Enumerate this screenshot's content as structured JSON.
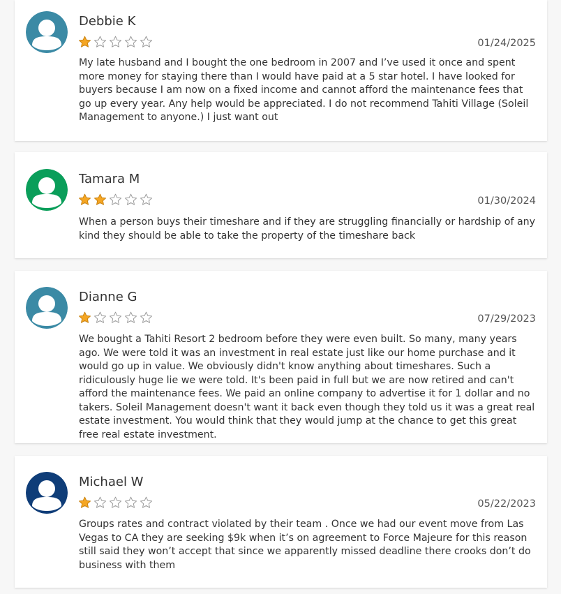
{
  "colors": {
    "star_filled": "#f5a623",
    "star_empty_outline": "#9a9a9a",
    "avatar_default": "#3b8aa5"
  },
  "reviews": [
    {
      "name": "Debbie K",
      "rating": 1,
      "max_rating": 5,
      "date": "01/24/2025",
      "avatar_color": "#3b8aa5",
      "avatar_icon": "user-silhouette-icon",
      "text": "My late husband and I bought the one bedroom in 2007 and I’ve used it once and spent more money for staying there than I would have paid at a 5 star hotel. I have looked for buyers because I am now on a fixed income and cannot afford the maintenance fees that go up every year. Any help would be appreciated. I do not recommend Tahiti Village (Soleil Management to anyone.) I just want out"
    },
    {
      "name": "Tamara M",
      "rating": 2,
      "max_rating": 5,
      "date": "01/30/2024",
      "avatar_color": "#0a9e5a",
      "avatar_icon": "user-silhouette-icon",
      "text": "When a person buys their timeshare and if they are struggling financially or hardship of any kind they should be able to take the property of the timeshare back"
    },
    {
      "name": "Dianne G",
      "rating": 1,
      "max_rating": 5,
      "date": "07/29/2023",
      "avatar_color": "#3b8aa5",
      "avatar_icon": "user-silhouette-icon",
      "text": "We bought a Tahiti Resort 2 bedroom before they were even built. So many, many years ago. We were told it was an investment in real estate just like our home purchase and it would go up in value. We obviously didn't know anything about timeshares. Such a ridiculously huge lie we were told. It's been paid in full but we are now retired and can't afford the maintenance fees. We paid an online company to advertise it for 1 dollar and no takers. Soleil Management doesn't want it back even though they told us it was a great real estate investment. You would think that they would jump at the chance to get this great free real estate investment."
    },
    {
      "name": "Michael W",
      "rating": 1,
      "max_rating": 5,
      "date": "05/22/2023",
      "avatar_color": "#0f3d78",
      "avatar_icon": "user-silhouette-icon",
      "text": "Groups rates and contract violated by their team . Once we had our event move from Las Vegas to CA they are seeking $9k when it’s on agreement to Force Majeure for this reason still said they won’t accept that since we apparently missed deadline there crooks don’t do business with them"
    }
  ]
}
